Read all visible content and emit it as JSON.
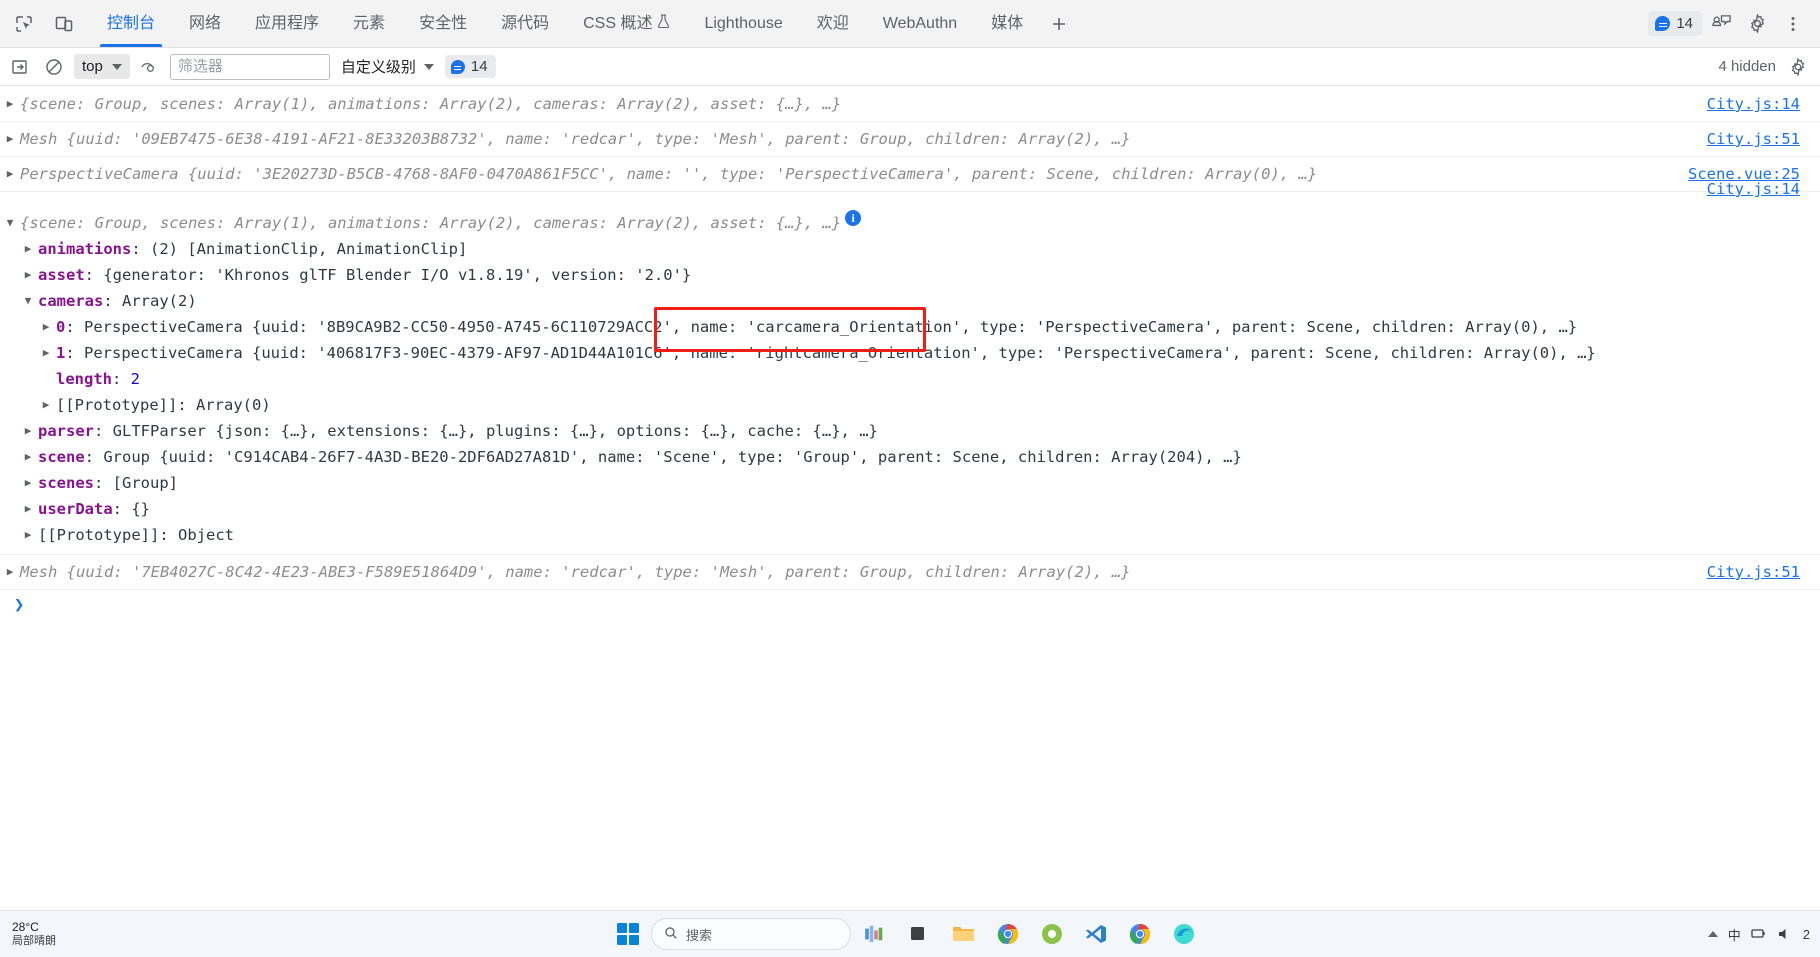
{
  "devtools": {
    "tool_icons": [
      {
        "name": "inspect-element-icon",
        "title": "Inspect"
      },
      {
        "name": "device-toolbar-icon",
        "title": "Toggle device toolbar"
      }
    ],
    "tabs": [
      {
        "label": "控制台",
        "active": true
      },
      {
        "label": "网络",
        "active": false
      },
      {
        "label": "应用程序",
        "active": false
      },
      {
        "label": "元素",
        "active": false
      },
      {
        "label": "安全性",
        "active": false
      },
      {
        "label": "源代码",
        "active": false
      },
      {
        "label": "CSS 概述",
        "active": false,
        "icon": "flask-icon"
      },
      {
        "label": "Lighthouse",
        "active": false
      },
      {
        "label": "欢迎",
        "active": false
      },
      {
        "label": "WebAuthn",
        "active": false
      },
      {
        "label": "媒体",
        "active": false
      }
    ],
    "add_tab_label": "+",
    "message_badge_count": "14",
    "right_icons": [
      {
        "name": "feedback-icon"
      },
      {
        "name": "settings-gear-icon"
      },
      {
        "name": "more-options-icon"
      }
    ]
  },
  "console_toolbar": {
    "clear_console_title": "清除控制台",
    "no_entry_title": "无",
    "context_value": "top",
    "eye_title": "实时表达式",
    "filter_placeholder": "筛选器",
    "filter_value": "",
    "level_label": "自定义级别",
    "issue_count": "14",
    "hidden_label": "4 hidden",
    "settings_title": "控制台设置"
  },
  "console": {
    "rows": [
      {
        "arrow": "collapsed",
        "source": "City.js:14",
        "tokens": [
          {
            "t": "{scene: ",
            "c": "t-dim"
          },
          {
            "t": "Group",
            "c": "t-dim"
          },
          {
            "t": ", scenes: ",
            "c": "t-dim"
          },
          {
            "t": "Array(1)",
            "c": "t-dim"
          },
          {
            "t": ", animations: ",
            "c": "t-dim"
          },
          {
            "t": "Array(2)",
            "c": "t-dim"
          },
          {
            "t": ", cameras: ",
            "c": "t-dim"
          },
          {
            "t": "Array(2)",
            "c": "t-dim"
          },
          {
            "t": ", asset: {…}, …}",
            "c": "t-dim"
          }
        ],
        "plain": "{scene: Group, scenes: Array(1), animations: Array(2), cameras: Array(2), asset: {…}, …}"
      },
      {
        "arrow": "collapsed",
        "source": "City.js:51",
        "plain": "Mesh {uuid: '09EB7475-6E38-4191-AF21-8E33203B8732', name: 'redcar', type: 'Mesh', parent: Group, children: Array(2), …}"
      },
      {
        "arrow": "collapsed",
        "source": "Scene.vue:25",
        "plain": "PerspectiveCamera {uuid: '3E20273D-B5CB-4768-8AF0-0470A861F5CC', name: '', type: 'PerspectiveCamera', parent: Scene, children: Array(0), …}"
      }
    ],
    "expanded_group": {
      "source": "City.js:14",
      "header": "{scene: Group, scenes: Array(1), animations: Array(2), cameras: Array(2), asset: {…}, …}",
      "info_badge": "i",
      "props": [
        {
          "indent": 1,
          "arrow": "collapsed",
          "key": "animations",
          "value": "(2) [AnimationClip, AnimationClip]"
        },
        {
          "indent": 1,
          "arrow": "collapsed",
          "key": "asset",
          "value": "{generator: 'Khronos glTF Blender I/O v1.8.19', version: '2.0'}"
        },
        {
          "indent": 1,
          "arrow": "expanded",
          "key": "cameras",
          "value": "Array(2)"
        },
        {
          "indent": 2,
          "arrow": "collapsed",
          "key": "0",
          "value": "PerspectiveCamera {uuid: '8B9CA9B2-CC50-4950-A745-6C110729ACC2', name: 'carcamera_Orientation', type: 'PerspectiveCamera', parent: Scene, children: Array(0), …}"
        },
        {
          "indent": 2,
          "arrow": "collapsed",
          "key": "1",
          "value": "PerspectiveCamera {uuid: '406817F3-90EC-4379-AF97-AD1D44A101C6', name: 'rightcamera_Orientation', type: 'PerspectiveCamera', parent: Scene, children: Array(0), …}"
        },
        {
          "indent": 2,
          "arrow": "none",
          "key": "length",
          "value": "2"
        },
        {
          "indent": 2,
          "arrow": "collapsed",
          "key": "[[Prototype]]",
          "value": "Array(0)"
        },
        {
          "indent": 1,
          "arrow": "collapsed",
          "key": "parser",
          "value": "GLTFParser {json: {…}, extensions: {…}, plugins: {…}, options: {…}, cache: {…}, …}"
        },
        {
          "indent": 1,
          "arrow": "collapsed",
          "key": "scene",
          "value": "Group {uuid: 'C914CAB4-26F7-4A3D-BE20-2DF6AD27A81D', name: 'Scene', type: 'Group', parent: Scene, children: Array(204), …}"
        },
        {
          "indent": 1,
          "arrow": "collapsed",
          "key": "scenes",
          "value": "[Group]"
        },
        {
          "indent": 1,
          "arrow": "collapsed",
          "key": "userData",
          "value": "{}"
        },
        {
          "indent": 1,
          "arrow": "collapsed",
          "key": "[[Prototype]]",
          "value": "Object"
        }
      ]
    },
    "last_row": {
      "arrow": "collapsed",
      "source": "City.js:51",
      "plain": "Mesh {uuid: '7EB4027C-8C42-4E23-ABE3-F589E51864D9', name: 'redcar', type: 'Mesh', parent: Group, children: Array(2), …}"
    },
    "prompt_caret": "❯"
  },
  "annotation": {
    "box_color": "#f01e14",
    "highlighted_rows": [
      "name: 'carcamera_Orientation',",
      "name: 'rightcamera_Orientation'"
    ]
  },
  "taskbar": {
    "weather_temp": "28°C",
    "weather_condition": "局部晴朗",
    "start_name": "windows-start-button",
    "search_placeholder": "搜索",
    "apps": [
      {
        "name": "widgets-icon"
      },
      {
        "name": "task-view-icon"
      },
      {
        "name": "file-explorer-icon"
      },
      {
        "name": "chrome-icon"
      },
      {
        "name": "chrome-canary-icon"
      },
      {
        "name": "vscode-icon"
      },
      {
        "name": "chrome-beta-icon"
      },
      {
        "name": "edge-dev-icon"
      }
    ],
    "tray": {
      "ime": "中",
      "show_hidden": "chevron-up-icon",
      "network": "network-icon",
      "volume": "volume-icon",
      "count": "2"
    }
  }
}
